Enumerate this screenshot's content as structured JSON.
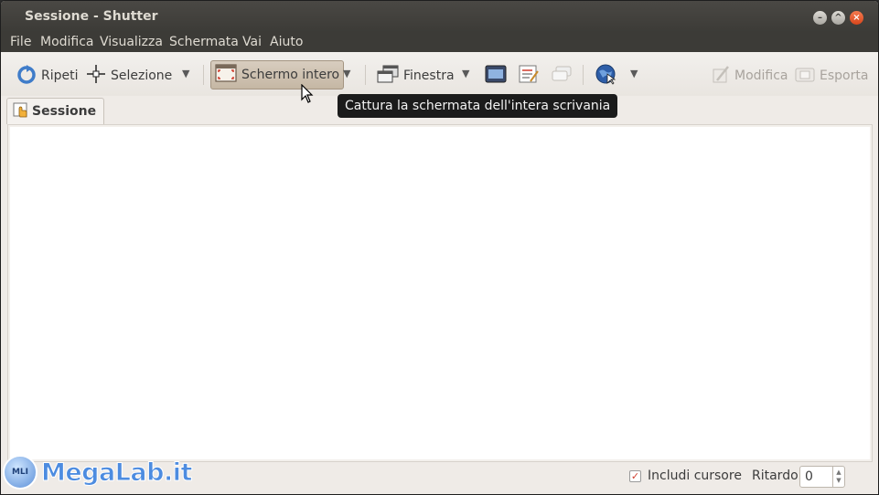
{
  "window": {
    "title": "Sessione - Shutter",
    "controls": {
      "minimize": "–",
      "maximize": "^",
      "close": "×"
    }
  },
  "menubar": {
    "items": [
      {
        "label": "File"
      },
      {
        "label": "Modifica"
      },
      {
        "label": "Visualizza"
      },
      {
        "label": "Schermata"
      },
      {
        "label": "Vai"
      },
      {
        "label": "Aiuto"
      }
    ]
  },
  "toolbar": {
    "repeat_label": "Ripeti",
    "selection_label": "Selezione",
    "fullscreen_label": "Schermo intero",
    "window_label": "Finestra",
    "edit_label": "Modifica",
    "export_label": "Esporta",
    "dropdown_glyph": "▼",
    "icons": [
      "refresh-icon",
      "crosshair-icon",
      "fullscreen-icon",
      "window-icon",
      "section-icon",
      "menu-icon",
      "tooltip-icon",
      "web-icon",
      "edit-icon",
      "export-icon"
    ]
  },
  "tooltip": {
    "text": "Cattura la schermata dell'intera scrivania"
  },
  "tabs": [
    {
      "label": "Sessione",
      "active": true
    }
  ],
  "statusbar": {
    "include_cursor_label": "Includi cursore",
    "include_cursor_checked": true,
    "checkmark": "✓",
    "delay_label": "Ritardo:",
    "delay_value": "0",
    "spin_up": "▲",
    "spin_down": "▼"
  },
  "watermark": {
    "logo_text": "MLI",
    "text": "MegaLab.it"
  },
  "colors": {
    "titlebar": "#3c3b37",
    "window_bg": "#efebe7",
    "tooltip_bg": "#1b1b1b",
    "close_button": "#e0572a"
  }
}
